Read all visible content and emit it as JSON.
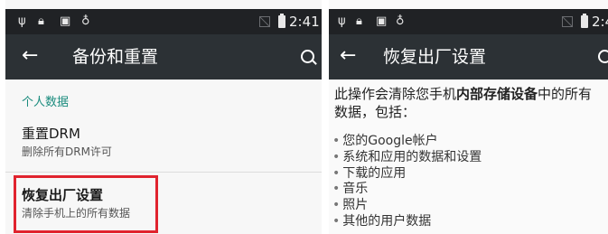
{
  "left_screen": {
    "status_bar": {
      "icons": [
        "usb-icon",
        "lock-icon",
        "clipboard-icon",
        "android-debug-icon",
        "no-sim-icon",
        "battery-icon"
      ],
      "time": "2:41"
    },
    "app_bar": {
      "back_icon": "←",
      "title": "备份和重置",
      "search_icon": "search-icon"
    },
    "section_header": "个人数据",
    "items": [
      {
        "title": "重置DRM",
        "summary": "删除所有DRM许可"
      },
      {
        "title": "恢复出厂设置",
        "summary": "清除手机上的所有数据"
      }
    ],
    "highlight_color": "#e0232e"
  },
  "right_screen": {
    "status_bar": {
      "icons": [
        "usb-icon",
        "lock-icon",
        "clipboard-icon",
        "android-debug-icon",
        "no-sim-icon",
        "battery-icon"
      ],
      "time": "2:4"
    },
    "app_bar": {
      "back_icon": "←",
      "title": "恢复出厂设置",
      "search_icon": "search-icon"
    },
    "warning": {
      "prefix": "此操作会清除您手机",
      "bold": "内部存储设备",
      "suffix": "中的所有数据，包括："
    },
    "data_list": [
      "您的Google帐户",
      "系统和应用的数据和设置",
      "下载的应用",
      "音乐",
      "照片",
      "其他的用户数据"
    ]
  },
  "colors": {
    "status_bar": "#202225",
    "app_bar": "#2c3135",
    "accent": "#1b8c7e"
  }
}
